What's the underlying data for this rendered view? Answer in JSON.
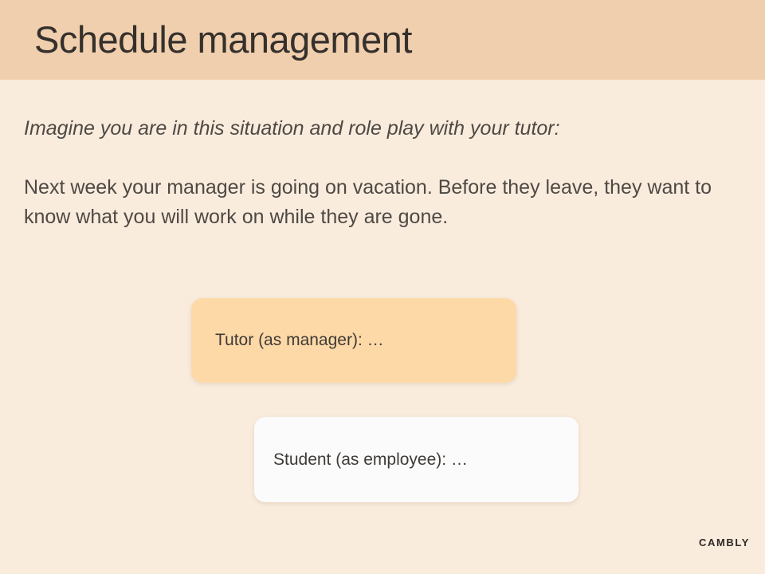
{
  "header": {
    "title": "Schedule management"
  },
  "content": {
    "instruction": "Imagine you are in this situation and role play with your tutor:",
    "scenario": "Next week your manager is going on vacation. Before they leave, they want to know what you will work on while they are gone."
  },
  "dialogue": [
    {
      "speaker_line": "Tutor (as manager): …"
    },
    {
      "speaker_line": "Student (as employee): …"
    }
  ],
  "footer": {
    "logo_text": "CAMBLY"
  },
  "colors": {
    "background": "#faecdd",
    "header": "#f0cfae",
    "tutor_bubble": "#fdd9a8",
    "student_bubble": "#fbfbfb"
  }
}
